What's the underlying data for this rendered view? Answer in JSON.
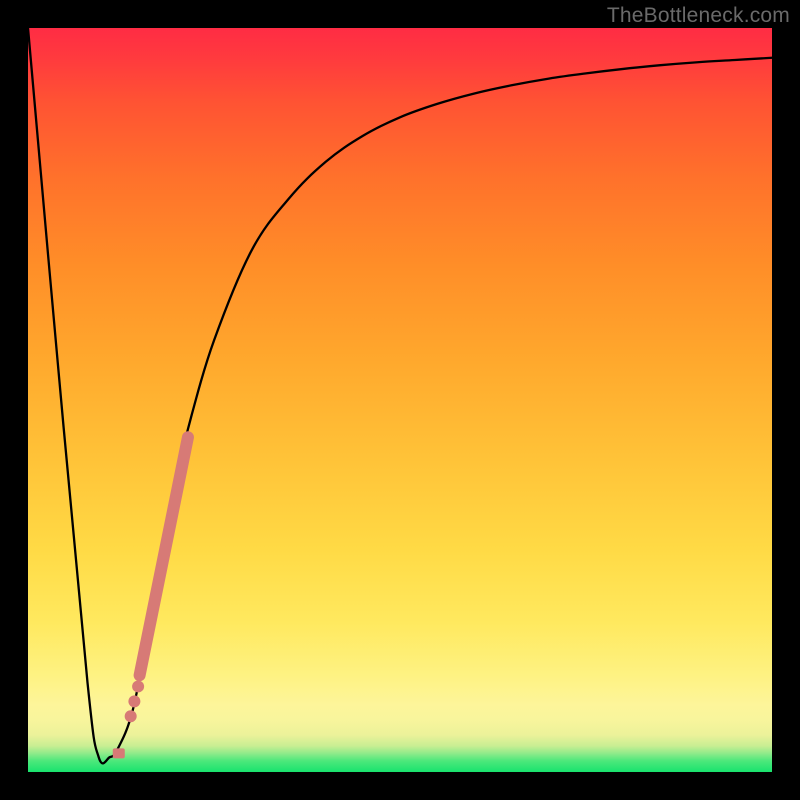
{
  "watermark": "TheBottleneck.com",
  "chart_data": {
    "type": "line",
    "title": "",
    "xlabel": "",
    "ylabel": "",
    "xlim": [
      0,
      100
    ],
    "ylim": [
      0,
      100
    ],
    "grid": false,
    "background": "vertical-gradient-green-to-red",
    "series": [
      {
        "name": "bottleneck-curve",
        "style": "black-thin-line",
        "x": [
          0,
          4,
          8,
          9.5,
          11,
          12,
          14,
          16,
          17,
          18,
          20,
          22,
          25,
          30,
          35,
          40,
          45,
          50,
          55,
          60,
          65,
          70,
          75,
          80,
          85,
          90,
          95,
          100
        ],
        "y": [
          100,
          55,
          12,
          2,
          2,
          3,
          8,
          18,
          24,
          30,
          40,
          48,
          58,
          70,
          77,
          82,
          85.5,
          88,
          89.8,
          91.2,
          92.3,
          93.2,
          93.9,
          94.5,
          95,
          95.4,
          95.7,
          96
        ]
      },
      {
        "name": "highlight-range",
        "style": "salmon-thick-line",
        "x": [
          15.0,
          21.5
        ],
        "y": [
          13.0,
          45.0
        ]
      },
      {
        "name": "highlight-dots",
        "style": "salmon-dots",
        "points": [
          {
            "x": 13.8,
            "y": 7.5
          },
          {
            "x": 14.3,
            "y": 9.5
          },
          {
            "x": 14.8,
            "y": 11.5
          }
        ]
      },
      {
        "name": "bottom-marker",
        "style": "salmon-small-rect",
        "x": 12.2,
        "y": 2.5
      }
    ]
  }
}
